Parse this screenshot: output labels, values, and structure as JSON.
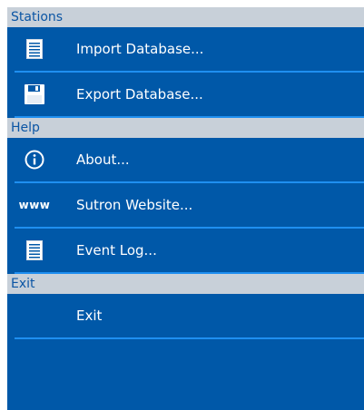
{
  "sections": [
    {
      "title": "Stations",
      "items": [
        {
          "label": "Import Database...",
          "icon": "document-lines-icon"
        },
        {
          "label": "Export Database...",
          "icon": "floppy-disk-icon"
        }
      ]
    },
    {
      "title": "Help",
      "items": [
        {
          "label": "About...",
          "icon": "info-circle-icon"
        },
        {
          "label": "Sutron Website...",
          "icon": "www-icon",
          "icon_text": "www"
        },
        {
          "label": "Event Log...",
          "icon": "document-lines-icon"
        }
      ]
    },
    {
      "title": "Exit",
      "items": [
        {
          "label": "Exit",
          "icon": ""
        }
      ]
    }
  ],
  "colors": {
    "panel": "#0058a8",
    "header_bg": "#c8d0d9",
    "header_text": "#0b55a4",
    "divider": "#1f8ff0"
  }
}
